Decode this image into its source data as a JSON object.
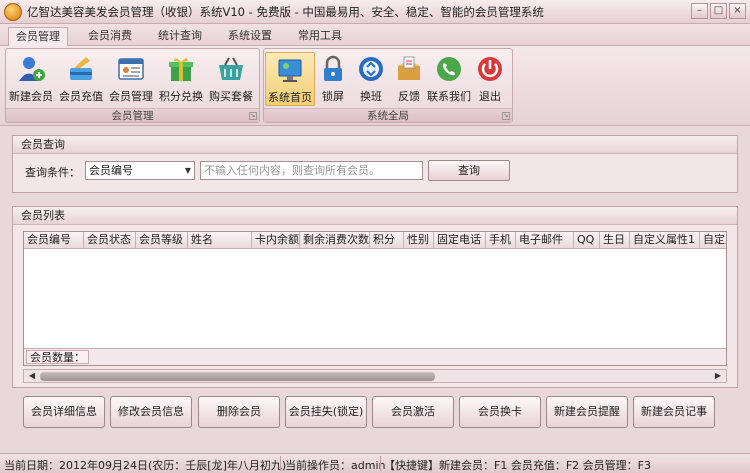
{
  "window": {
    "title": "亿智达美容美发会员管理（收银）系统V10 - 免费版 - 中国最易用、安全、稳定、智能的会员管理系统",
    "controls": [
      "–",
      "□",
      "×"
    ]
  },
  "tabs": [
    "会员管理",
    "会员消费",
    "统计查询",
    "系统设置",
    "常用工具"
  ],
  "ribbon": {
    "member_group": {
      "label": "会员管理",
      "buttons": [
        "新建会员",
        "会员充值",
        "会员管理",
        "积分兑换",
        "购买套餐"
      ]
    },
    "system_group": {
      "label": "系统全局",
      "buttons": [
        "系统首页",
        "锁屏",
        "换班",
        "反馈",
        "联系我们",
        "退出"
      ]
    }
  },
  "query": {
    "section_title": "会员查询",
    "condition_label": "查询条件：",
    "condition_value": "会员编号",
    "input_placeholder": "不输入任何内容，则查询所有会员。",
    "button": "查询"
  },
  "list": {
    "section_title": "会员列表",
    "columns": [
      "会员编号",
      "会员状态",
      "会员等级",
      "姓名",
      "卡内余额",
      "剩余消费次数",
      "积分",
      "性别",
      "固定电话",
      "手机",
      "电子邮件",
      "QQ",
      "生日",
      "自定义属性1",
      "自定义"
    ],
    "count_label": "会员数量："
  },
  "actions": [
    "会员详细信息",
    "修改会员信息",
    "删除会员",
    "会员挂失(锁定)",
    "会员激活",
    "会员换卡",
    "新建会员提醒",
    "新建会员记事"
  ],
  "status": {
    "date": "当前日期：2012年09月24日(农历：壬辰[龙]年八月初九)",
    "operator": "当前操作员：admin",
    "shortcuts": "【快捷键】新建会员：F1  会员充值：F2  会员管理：F3"
  },
  "colors": {
    "chrome": "#e8d8dc",
    "selected_button": "#f3cf73"
  }
}
